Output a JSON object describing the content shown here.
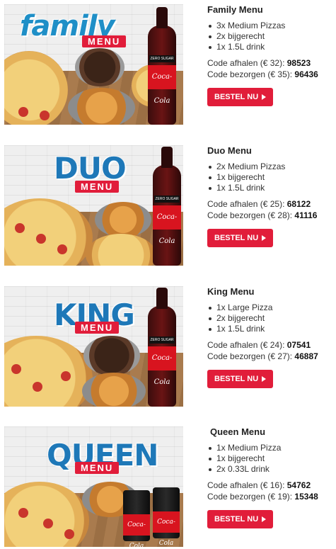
{
  "menus": [
    {
      "brand": "family",
      "tag": "MENU",
      "title": "Family Menu",
      "items": [
        "3x Medium Pizzas",
        "2x bijgerecht",
        "1x 1.5L drink"
      ],
      "pickup_label": "Code afhalen (€ 32):",
      "pickup_code": "98523",
      "delivery_label": "Code bezorgen (€ 35):",
      "delivery_code": "96436",
      "button": "BESTEL NU"
    },
    {
      "brand": "DUO",
      "tag": "MENU",
      "title": "Duo Menu",
      "items": [
        "2x Medium Pizzas",
        "1x bijgerecht",
        "1x 1.5L drink"
      ],
      "pickup_label": "Code afhalen (€ 25):",
      "pickup_code": "68122",
      "delivery_label": "Code bezorgen (€ 28):",
      "delivery_code": "41116",
      "button": "BESTEL NU"
    },
    {
      "brand": "KING",
      "tag": "MENU",
      "title": "King Menu",
      "items": [
        "1x Large Pizza",
        "2x bijgerecht",
        "1x 1.5L drink"
      ],
      "pickup_label": "Code afhalen (€ 24):",
      "pickup_code": "07541",
      "delivery_label": "Code bezorgen (€ 27):",
      "delivery_code": "46887",
      "button": "BESTEL NU"
    },
    {
      "brand": "QUEEN",
      "tag": "MENU",
      "title": "Queen Menu",
      "items": [
        "1x Medium Pizza",
        "1x bijgerecht",
        "2x 0.33L drink"
      ],
      "pickup_label": "Code afhalen (€ 16):",
      "pickup_code": "54762",
      "delivery_label": "Code bezorgen (€ 19):",
      "delivery_code": "15348",
      "button": "BESTEL NU"
    }
  ],
  "drink_label": "Coca-Cola",
  "zero_label": "ZERO SUGAR",
  "colors": {
    "accent": "#e11d3a",
    "brand_blue": "#1f8fc7"
  }
}
